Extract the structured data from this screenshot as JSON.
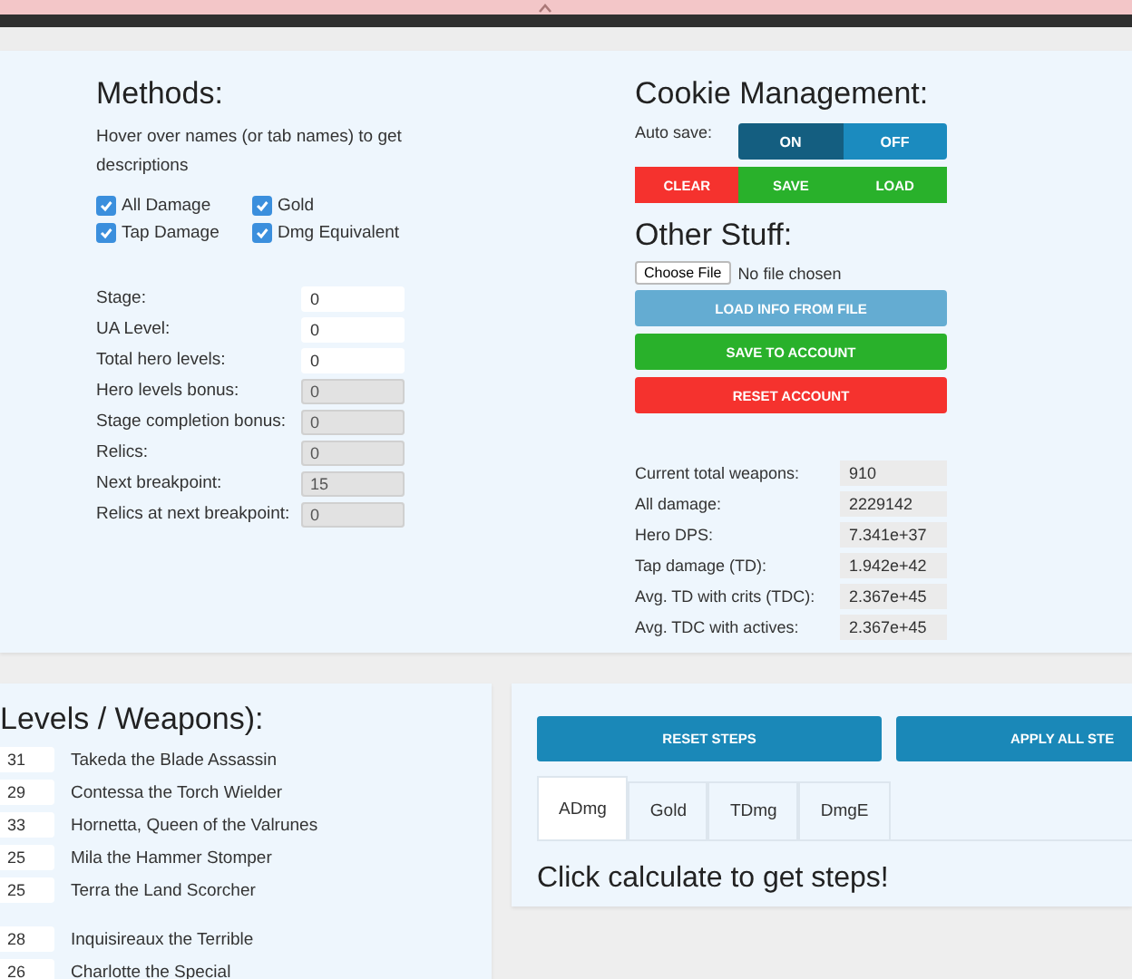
{
  "methods": {
    "title": "Methods:",
    "hint": "Hover over names (or tab names) to get descriptions",
    "checkboxes": [
      {
        "label": "All Damage",
        "checked": true
      },
      {
        "label": "Gold",
        "checked": true
      },
      {
        "label": "Tap Damage",
        "checked": true
      },
      {
        "label": "Dmg Equivalent",
        "checked": true
      }
    ],
    "fields": [
      {
        "label": "Stage:",
        "value": "0",
        "readonly": false
      },
      {
        "label": "UA Level:",
        "value": "0",
        "readonly": false
      },
      {
        "label": "Total hero levels:",
        "value": "0",
        "readonly": false
      },
      {
        "label": "Hero levels bonus:",
        "value": "0",
        "readonly": true
      },
      {
        "label": "Stage completion bonus:",
        "value": "0",
        "readonly": true
      },
      {
        "label": "Relics:",
        "value": "0",
        "readonly": true
      },
      {
        "label": "Next breakpoint:",
        "value": "15",
        "readonly": true
      },
      {
        "label": "Relics at next breakpoint:",
        "value": "0",
        "readonly": true
      }
    ]
  },
  "cookies": {
    "title": "Cookie Management:",
    "autosave_label": "Auto save:",
    "autosave": [
      {
        "label": "ON",
        "selected": true
      },
      {
        "label": "OFF",
        "selected": false
      }
    ],
    "buttons": [
      {
        "label": "CLEAR",
        "kind": "danger"
      },
      {
        "label": "SAVE",
        "kind": "success"
      },
      {
        "label": "LOAD",
        "kind": "success"
      }
    ]
  },
  "other": {
    "title": "Other Stuff:",
    "file_button": "Choose File",
    "file_status": "No file chosen",
    "buttons": [
      {
        "label": "LOAD INFO FROM FILE",
        "kind": "info"
      },
      {
        "label": "SAVE TO ACCOUNT",
        "kind": "success"
      },
      {
        "label": "RESET ACCOUNT",
        "kind": "danger"
      }
    ]
  },
  "stats": [
    {
      "label": "Current total weapons:",
      "value": "910"
    },
    {
      "label": "All damage:",
      "value": "2229142"
    },
    {
      "label": "Hero DPS:",
      "value": "7.341e+37"
    },
    {
      "label": "Tap damage (TD):",
      "value": "1.942e+42"
    },
    {
      "label": "Avg. TD with crits (TDC):",
      "value": "2.367e+45"
    },
    {
      "label": "Avg. TDC with actives:",
      "value": "2.367e+45"
    }
  ],
  "heroes": {
    "title": "Levels / Weapons):",
    "groups": [
      [
        {
          "level": "31",
          "name": "Takeda the Blade Assassin"
        },
        {
          "level": "29",
          "name": "Contessa the Torch Wielder"
        },
        {
          "level": "33",
          "name": "Hornetta, Queen of the Valrunes"
        },
        {
          "level": "25",
          "name": "Mila the Hammer Stomper"
        },
        {
          "level": "25",
          "name": "Terra the Land Scorcher"
        }
      ],
      [
        {
          "level": "28",
          "name": "Inquisireaux the Terrible"
        },
        {
          "level": "26",
          "name": "Charlotte the Special"
        }
      ]
    ]
  },
  "steps": {
    "buttons": [
      "RESET STEPS",
      "APPLY ALL STE"
    ],
    "tabs": [
      {
        "label": "ADmg",
        "selected": true
      },
      {
        "label": "Gold",
        "selected": false
      },
      {
        "label": "TDmg",
        "selected": false
      },
      {
        "label": "DmgE",
        "selected": false
      }
    ],
    "message": "Click calculate to get steps!"
  }
}
